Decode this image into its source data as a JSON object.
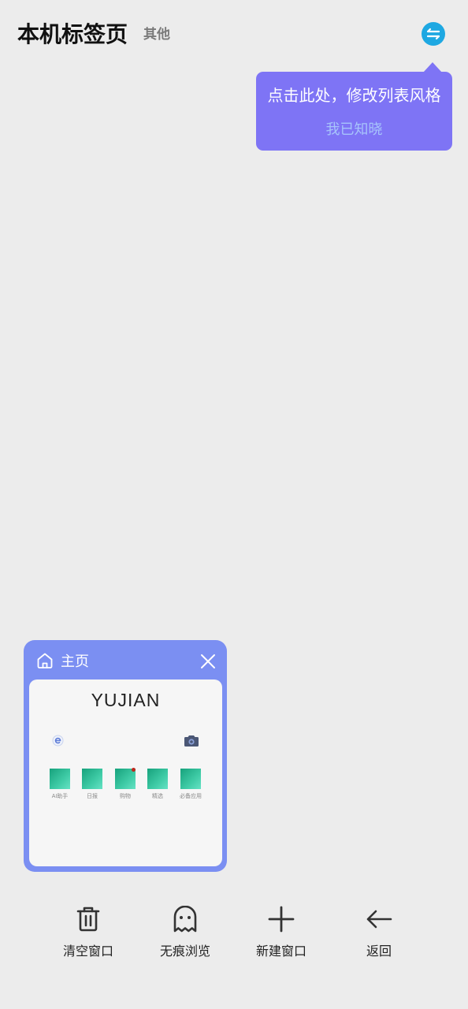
{
  "header": {
    "title": "本机标签页",
    "other_tab": "其他",
    "switch_icon": "swap-icon"
  },
  "tooltip": {
    "message": "点击此处，修改列表风格",
    "dismiss": "我已知晓"
  },
  "tabs": [
    {
      "title": "主页",
      "icon": "home-icon",
      "close_icon": "close-icon",
      "preview": {
        "logo": "YUJIAN",
        "left_icon": "browser-e-icon",
        "right_icon": "camera-icon",
        "shortcuts": [
          {
            "label": "AI助手",
            "badge": false
          },
          {
            "label": "日报",
            "badge": false
          },
          {
            "label": "购物",
            "badge": true
          },
          {
            "label": "精选",
            "badge": false
          },
          {
            "label": "必备应用",
            "badge": false
          }
        ]
      }
    }
  ],
  "toolbar": {
    "items": [
      {
        "label": "清空窗口",
        "icon": "trash-icon"
      },
      {
        "label": "无痕浏览",
        "icon": "ghost-icon"
      },
      {
        "label": "新建窗口",
        "icon": "plus-icon"
      },
      {
        "label": "返回",
        "icon": "back-arrow-icon"
      }
    ]
  },
  "colors": {
    "background": "#ececec",
    "switch_button": "#1ea8e2",
    "tooltip": "#7e74f5",
    "tooltip_dismiss": "#a7c4fb",
    "tab_card": "#7b8ff2",
    "badge": "#c0281e"
  }
}
